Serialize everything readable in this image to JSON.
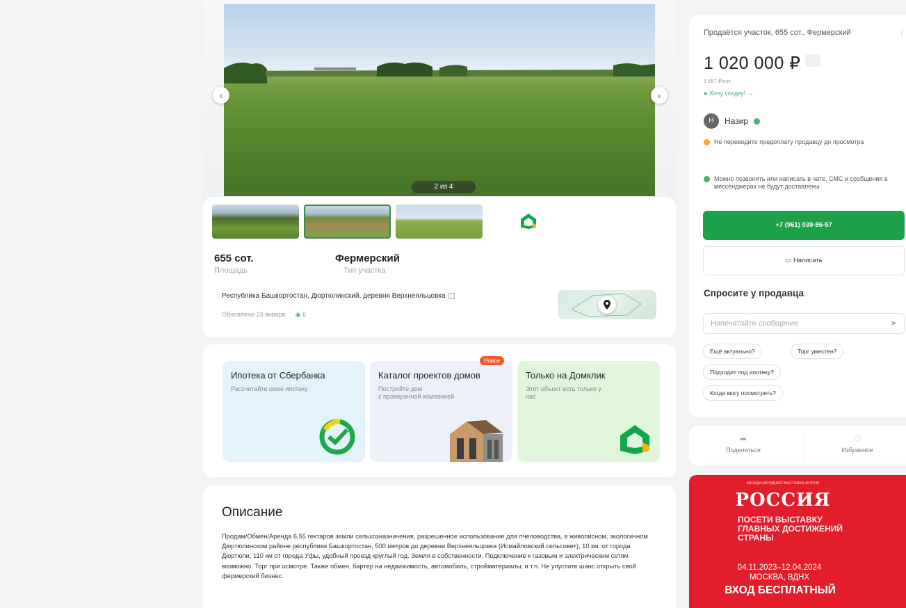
{
  "gallery": {
    "counter": "2 из 4",
    "prev_icon": "chevron-left-icon",
    "next_icon": "chevron-right-icon"
  },
  "params": {
    "area_value": "655 сот.",
    "area_label": "Площадь",
    "type_value": "Фермерский",
    "type_label": "Тип участка"
  },
  "location": {
    "address": "Республика Башкортостан, Дюртюлинский, деревня Верхнеяльцовка",
    "updated": "Обновлено 23 января",
    "views": "6"
  },
  "promos": [
    {
      "title": "Ипотека от Сбербанка",
      "subtitle": "Рассчитайте свою ипотеку"
    },
    {
      "title": "Каталог проектов домов",
      "subtitle": "Постройте дом\nс проверенной компанией",
      "badge": "Новое"
    },
    {
      "title": "Только на Домклик",
      "subtitle": "Этот объект есть только у нас"
    }
  ],
  "description": {
    "title": "Описание",
    "text": "Продам/Обмен/Аренда 6,55 гектаров земли сельхозназначения, разрешенное использование для пчеловодства, в живописном, экологичном Дюртюлинском районе республики Башкортостан, 500 метров до деревни Верхнеяльцовка (Исмайловский сельсовет), 10 км. от города Дюртюли, 110 км от города Уфы, удобный проезд круглый год. Земля в собственности. Подключение к газовым и электрическим сетям возможно. Торг при осмотре. Также обмен, бартер на недвижимость, автомобиль, стройматериалы, и т.п. Не упустите шанс открыть свой фермерский бизнес."
  },
  "sidebar": {
    "title": "Продаётся участок, 655 сот., Фермерский",
    "price": "1 020 000 ₽",
    "price_per": "1 557 ₽/сот.",
    "discount": "Хочу скидку! →",
    "seller_initial": "Н",
    "seller_name": "Назир",
    "warning": "Не переводите предоплату продавцу до просмотра",
    "info": "Можно позвонить или написать в чате, СМС и сообщения в мессенджерах не будут доставлены",
    "phone": "+7 (961) 039-86-57",
    "write": "Написать",
    "ask_title": "Спросите у продавца",
    "message_placeholder": "Напечатайте сообщение",
    "chips": [
      "Ещё актуально?",
      "Торг уместен?",
      "Подходит под ипотеку?",
      "Когда могу посмотреть?"
    ]
  },
  "actions": {
    "share": "Поделиться",
    "favorite": "Избранное"
  },
  "banner": {
    "top": "МЕЖДУНАРОДНАЯ ВЫСТАВКА-ФОРУМ",
    "logo": "РОССИЯ",
    "line1": "ПОСЕТИ ВЫСТАВКУ",
    "line2": "ГЛАВНЫХ ДОСТИЖЕНИЙ",
    "line3": "СТРАНЫ",
    "dates": "04.11.2023–12.04.2024",
    "place": "МОСКВА, ВДНХ",
    "free": "ВХОД БЕСПЛАТНЫЙ"
  },
  "colors": {
    "accent_green": "#1da14a",
    "banner_red": "#e31d2c",
    "badge_orange": "#f25a28"
  }
}
